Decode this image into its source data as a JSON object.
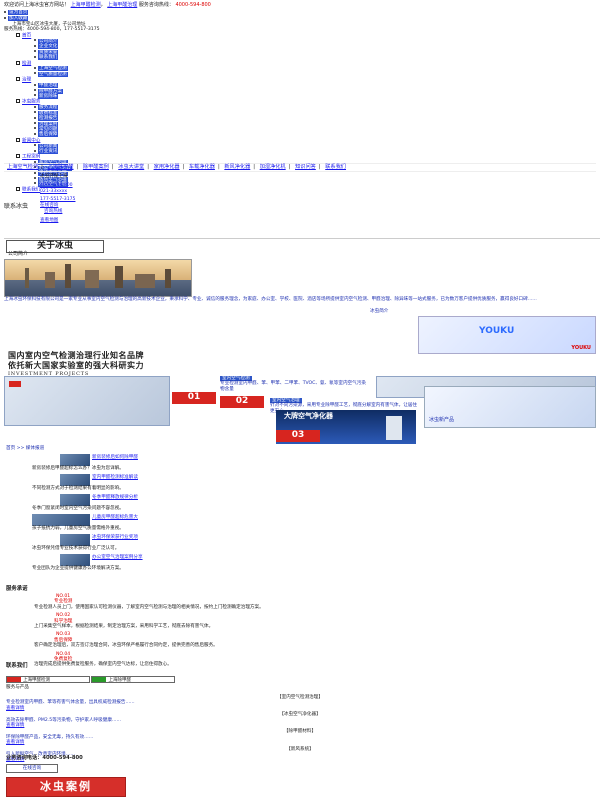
{
  "topbar": {
    "welcome": "欢迎访问上海冰虫官方网站！",
    "link1": "上海甲醛检测",
    "link2": "上海甲醛治理",
    "hotline_label": "服务咨询热线：",
    "hotline": "4000-594-800"
  },
  "header_links": [
    "设为首页",
    "加入收藏"
  ],
  "address": "上海市宝山区冰虫大厦，子公司地址",
  "phone_line": "服务热线：4000-594-800，177-5517-3175",
  "menu": [
    {
      "title": "首页",
      "items": [
        "公司简介",
        "企业文化",
        "资质荣誉",
        "联系我们"
      ]
    },
    {
      "title": "检测",
      "items": [
        "上海空气检测",
        "空气质量检测"
      ]
    },
    {
      "title": "治理",
      "items": [
        "甲醛治理",
        "除甲醛方案",
        "新房除味"
      ]
    },
    {
      "title": "冰虫服务",
      "items": [
        "服务流程",
        "收费标准",
        "检测报告",
        "治理案例",
        "常见问题",
        "售后保障"
      ]
    },
    {
      "title": "新闻中心",
      "items": [
        "公司新闻",
        "行业资讯"
      ]
    },
    {
      "title": "工程案例",
      "items": [
        "家装空气治理",
        "办公室空气治理",
        "学校空气治理",
        "医院空气治理",
        "酒店空气治理"
      ]
    },
    {
      "title": "联系我们",
      "items": []
    }
  ],
  "nav": [
    "上海空气检测",
    "上海除甲醛",
    "除甲醛案例",
    "冰虫大讲堂",
    "家用净化器",
    "车载净化器",
    "新风净化器",
    "加湿净化机",
    "知识问答",
    "联系我们"
  ],
  "contact": {
    "label": "联系冰虫",
    "company": "冰虫环保上海",
    "tel_label": "咨询热线",
    "tel1": "4000-594-800",
    "tel2": "021-33xxxx",
    "mobile": "177-5517-3175",
    "qq_label": "在线咨询",
    "map_label": "查看地图"
  },
  "about": {
    "button": "关于冰虫",
    "section": "公司简介",
    "text": "上海冰虫环保科技有限公司是一家专业从事室内空气检测与治理的高新技术企业，秉承科学、专业、诚信的服务理念，为家庭、办公室、学校、医院、酒店等场所提供室内空气检测、甲醛治理、除异味等一站式服务，已为数万客户提供优质服务，赢得良好口碑……",
    "more": "冰虫简介"
  },
  "video_brand": "YOUKU",
  "slogan": {
    "line1": "国内室内空气检测治理行业知名品牌",
    "line2": "依托新大国家实验室的强大科研实力",
    "sub": "INVESTMENT  PROJECTS"
  },
  "projects": {
    "tab1": "室内空气检测",
    "desc1": "专业检测室内甲醛、苯、甲苯、二甲苯、TVOC、氨、氡等室内空气污染物含量",
    "tab2": "室内空气治理",
    "desc2": "针对不同污染源，采用专业除甲醛工艺，彻底分解室内有害气体，让居住更安心",
    "num1": "01",
    "num2": "02",
    "num3": "03",
    "banner_text": "大牌空气净化器",
    "product_label": "冰虫新产品"
  },
  "news": {
    "breadcrumb": "首页 >> 媒体报道",
    "items": [
      {
        "title": "新房装修后如何除甲醛",
        "desc": "新房装修后甲醛超标怎么办？冰虫为您详解。"
      },
      {
        "title": "室内甲醛检测标准解读",
        "desc": "不同检测方式对于检测结果有着明显的影响。"
      },
      {
        "title": "冬季甲醛释放规律分析",
        "desc": "冬季门窗紧闭时室内空气污染问题不容忽视。"
      },
      {
        "title": "儿童房甲醛超标危害大",
        "desc": "孩子抵抗力弱，儿童房空气质量需格外重视。"
      },
      {
        "title": "冰虫环保荣获行业奖项",
        "desc": "冰虫环保凭借专业技术获得行业广泛认可。"
      },
      {
        "title": "办公室空气治理案例分享",
        "desc": "专业团队为企业提供健康办公环境解决方案。"
      }
    ]
  },
  "service": {
    "title": "服务承诺",
    "items": [
      {
        "num": "NO.01",
        "head": "专业检测",
        "text": "专业检测人员上门，使用国家认可检测仪器，了解室内空气检测与治理的相关情况，按约上门检测确定治理方案。"
      },
      {
        "num": "NO.02",
        "head": "科学治理",
        "text": "上门采集空气样本，根据检测结果，制定治理方案，采用科学工艺，彻底去除有害气体。"
      },
      {
        "num": "NO.03",
        "head": "售后保障",
        "text": "客户确定治理后，双方签订治理合同，冰虫环保严格履行合同约定，提供完善的售后服务。"
      },
      {
        "num": "NO.04",
        "head": "免费复检",
        "text": "治理完成后提供免费复检服务，确保室内空气达标，让您住得放心。"
      }
    ]
  },
  "contact_us": "联系我们",
  "tags": [
    "上海甲醛检测",
    "上海除甲醛"
  ],
  "products_title": "服务与产品",
  "product_list": [
    {
      "title": "【室内空气检测治理】",
      "text": "专业检测室内甲醛、苯等有害气体含量，出具权威检测报告……",
      "more": "查看详情"
    },
    {
      "title": "【冰虫空气净化器】",
      "text": "高效去除甲醛、PM2.5等污染物，守护家人呼吸健康……",
      "more": "查看详情"
    },
    {
      "title": "【除甲醛材料】",
      "text": "环保除甲醛产品，安全无毒，持久有效……",
      "more": "查看详情"
    },
    {
      "title": "【新风系统】",
      "text": "引入新鲜空气，改善室内环境……",
      "more": "查看详情"
    }
  ],
  "hotline_bottom_label": "业务咨询电话：",
  "hotline_bottom": "4000-594-800",
  "online_btn": "在线咨询",
  "case_button": "冰虫案例"
}
